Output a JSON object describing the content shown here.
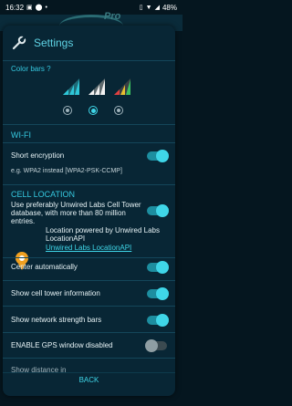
{
  "status": {
    "time": "16:32",
    "battery": "48%"
  },
  "brand": {
    "pro": "Pro"
  },
  "header": {
    "title": "Settings"
  },
  "color_bars": {
    "label": "Color bars ?",
    "options": [
      "teal",
      "white",
      "rainbow"
    ],
    "selected_index": 1
  },
  "wifi": {
    "section": "WI-FI",
    "short_encryption": {
      "label": "Short encryption",
      "on": true
    },
    "example": "e.g. WPA2 instead [WPA2-PSK-CCMP]"
  },
  "cell": {
    "section": "CELL LOCATION",
    "unwired": {
      "label": "Use preferably Unwired Labs Cell Tower database, with more than 80 million entries.",
      "on": true
    },
    "powered_by": "Location powered by Unwired Labs LocationAPI",
    "link": "Unwired Labs LocationAPI"
  },
  "settings": [
    {
      "label": "Center automatically",
      "on": true
    },
    {
      "label": "Show cell tower information",
      "on": true
    },
    {
      "label": "Show network strength bars",
      "on": true
    },
    {
      "label": "ENABLE GPS window disabled",
      "on": false
    }
  ],
  "partial_row": "Show distance in",
  "back": "BACK",
  "colors": {
    "accent": "#3fd6e8",
    "bg": "#082635"
  }
}
